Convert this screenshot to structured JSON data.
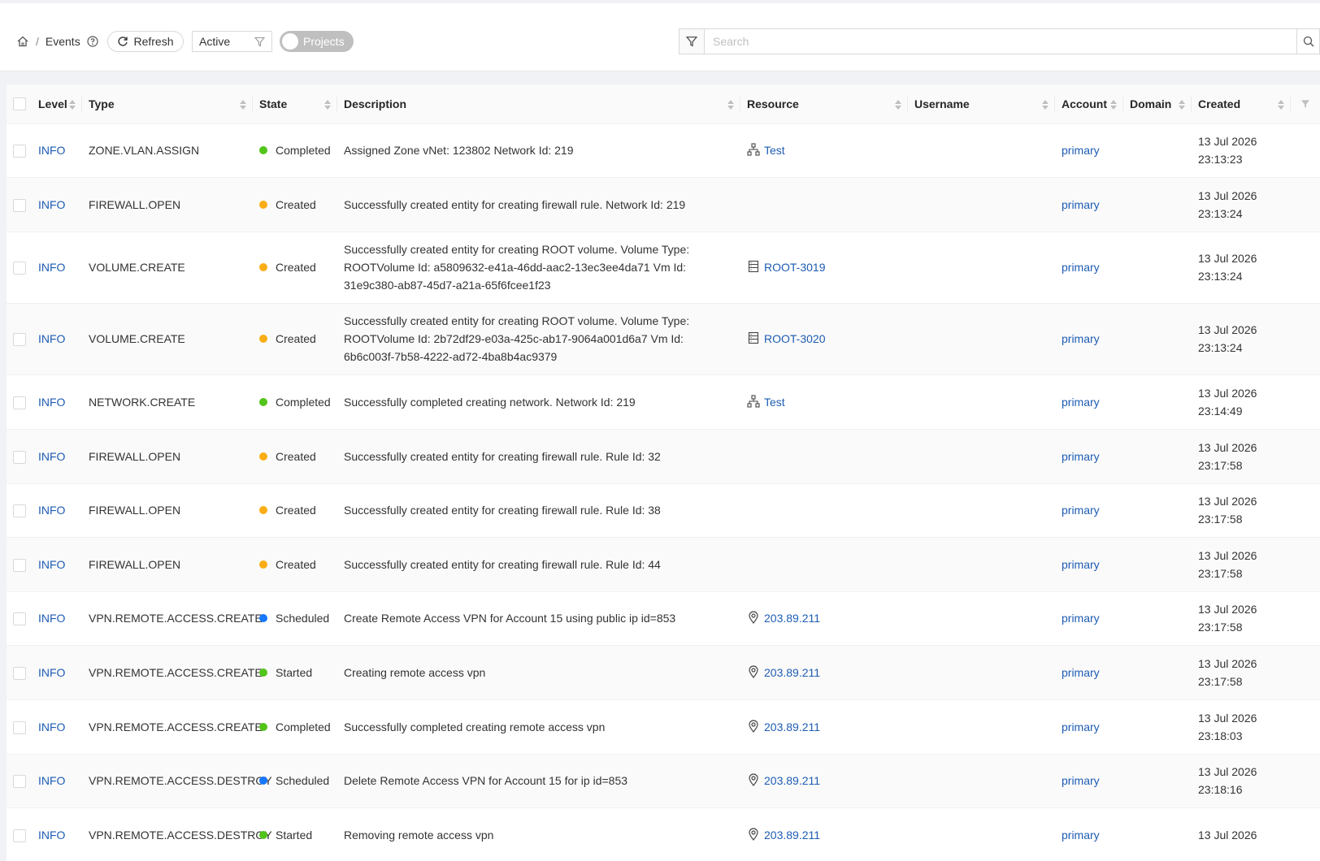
{
  "breadcrumb": {
    "current": "Events"
  },
  "toolbar": {
    "refresh_label": "Refresh",
    "filter_value": "Active",
    "projects_toggle_label": "Projects",
    "search_placeholder": "Search"
  },
  "table": {
    "columns": [
      "Level",
      "Type",
      "State",
      "Description",
      "Resource",
      "Username",
      "Account",
      "Domain",
      "Created"
    ],
    "rows": [
      {
        "level": "INFO",
        "type": "ZONE.VLAN.ASSIGN",
        "state": "Completed",
        "state_color": "#52c41a",
        "description": "Assigned Zone vNet: 123802 Network Id: 219",
        "resource": "Test",
        "resource_icon": "network-icon",
        "username": "",
        "account": "primary",
        "domain": "",
        "created_date": "13 Jul 2026",
        "created_time": "23:13:23"
      },
      {
        "level": "INFO",
        "type": "FIREWALL.OPEN",
        "state": "Created",
        "state_color": "#faad14",
        "description": "Successfully created entity for creating firewall rule. Network Id: 219",
        "resource": "",
        "resource_icon": "",
        "username": "",
        "account": "primary",
        "domain": "",
        "created_date": "13 Jul 2026",
        "created_time": "23:13:24"
      },
      {
        "level": "INFO",
        "type": "VOLUME.CREATE",
        "state": "Created",
        "state_color": "#faad14",
        "description": "Successfully created entity for creating ROOT volume. Volume Type: ROOTVolume Id: a5809632-e41a-46dd-aac2-13ec3ee4da71 Vm Id: 31e9c380-ab87-45d7-a21a-65f6fcee1f23",
        "resource": "ROOT-3019",
        "resource_icon": "volume-icon",
        "username": "",
        "account": "primary",
        "domain": "",
        "created_date": "13 Jul 2026",
        "created_time": "23:13:24"
      },
      {
        "level": "INFO",
        "type": "VOLUME.CREATE",
        "state": "Created",
        "state_color": "#faad14",
        "description": "Successfully created entity for creating ROOT volume. Volume Type: ROOTVolume Id: 2b72df29-e03a-425c-ab17-9064a001d6a7 Vm Id: 6b6c003f-7b58-4222-ad72-4ba8b4ac9379",
        "resource": "ROOT-3020",
        "resource_icon": "volume-icon",
        "username": "",
        "account": "primary",
        "domain": "",
        "created_date": "13 Jul 2026",
        "created_time": "23:13:24"
      },
      {
        "level": "INFO",
        "type": "NETWORK.CREATE",
        "state": "Completed",
        "state_color": "#52c41a",
        "description": "Successfully completed creating network. Network Id: 219",
        "resource": "Test",
        "resource_icon": "network-icon",
        "username": "",
        "account": "primary",
        "domain": "",
        "created_date": "13 Jul 2026",
        "created_time": "23:14:49"
      },
      {
        "level": "INFO",
        "type": "FIREWALL.OPEN",
        "state": "Created",
        "state_color": "#faad14",
        "description": "Successfully created entity for creating firewall rule. Rule Id: 32",
        "resource": "",
        "resource_icon": "",
        "username": "",
        "account": "primary",
        "domain": "",
        "created_date": "13 Jul 2026",
        "created_time": "23:17:58"
      },
      {
        "level": "INFO",
        "type": "FIREWALL.OPEN",
        "state": "Created",
        "state_color": "#faad14",
        "description": "Successfully created entity for creating firewall rule. Rule Id: 38",
        "resource": "",
        "resource_icon": "",
        "username": "",
        "account": "primary",
        "domain": "",
        "created_date": "13 Jul 2026",
        "created_time": "23:17:58"
      },
      {
        "level": "INFO",
        "type": "FIREWALL.OPEN",
        "state": "Created",
        "state_color": "#faad14",
        "description": "Successfully created entity for creating firewall rule. Rule Id: 44",
        "resource": "",
        "resource_icon": "",
        "username": "",
        "account": "primary",
        "domain": "",
        "created_date": "13 Jul 2026",
        "created_time": "23:17:58"
      },
      {
        "level": "INFO",
        "type": "VPN.REMOTE.ACCESS.CREATE",
        "state": "Scheduled",
        "state_color": "#1677ff",
        "description": "Create Remote Access VPN for Account 15 using public ip id=853",
        "resource": "203.89.211",
        "resource_icon": "location-icon",
        "username": "",
        "account": "primary",
        "domain": "",
        "created_date": "13 Jul 2026",
        "created_time": "23:17:58"
      },
      {
        "level": "INFO",
        "type": "VPN.REMOTE.ACCESS.CREATE",
        "state": "Started",
        "state_color": "#52c41a",
        "description": "Creating remote access vpn",
        "resource": "203.89.211",
        "resource_icon": "location-icon",
        "username": "",
        "account": "primary",
        "domain": "",
        "created_date": "13 Jul 2026",
        "created_time": "23:17:58"
      },
      {
        "level": "INFO",
        "type": "VPN.REMOTE.ACCESS.CREATE",
        "state": "Completed",
        "state_color": "#52c41a",
        "description": "Successfully completed creating remote access vpn",
        "resource": "203.89.211",
        "resource_icon": "location-icon",
        "username": "",
        "account": "primary",
        "domain": "",
        "created_date": "13 Jul 2026",
        "created_time": "23:18:03"
      },
      {
        "level": "INFO",
        "type": "VPN.REMOTE.ACCESS.DESTROY",
        "state": "Scheduled",
        "state_color": "#1677ff",
        "description": "Delete Remote Access VPN for Account 15 for ip id=853",
        "resource": "203.89.211",
        "resource_icon": "location-icon",
        "username": "",
        "account": "primary",
        "domain": "",
        "created_date": "13 Jul 2026",
        "created_time": "23:18:16"
      },
      {
        "level": "INFO",
        "type": "VPN.REMOTE.ACCESS.DESTROY",
        "state": "Started",
        "state_color": "#52c41a",
        "description": "Removing remote access vpn",
        "resource": "203.89.211",
        "resource_icon": "location-icon",
        "username": "",
        "account": "primary",
        "domain": "",
        "created_date": "13 Jul 2026",
        "created_time": ""
      }
    ]
  }
}
